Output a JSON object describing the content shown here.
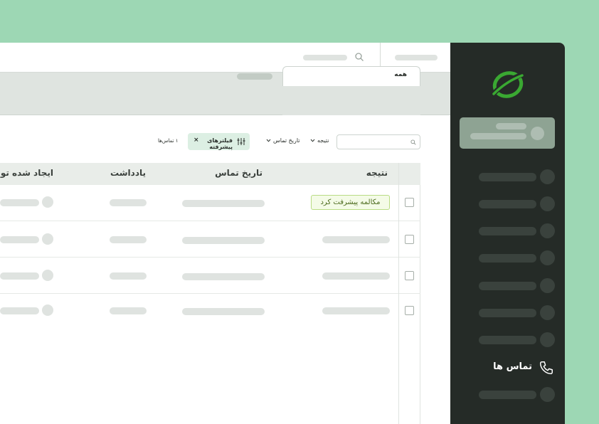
{
  "sidebar": {
    "contacts_label": "تماس ها"
  },
  "tabs": {
    "active_label": "همه"
  },
  "filters": {
    "result_label": "نتیجه",
    "contact_date_label": "تاریخ تماس",
    "advanced_label": "فیلترهای پیشرفته",
    "clear_symbol": "×",
    "count_label": "۱ تماس‌ها"
  },
  "table": {
    "headers": [
      "نتیجه",
      "تاریخ تماس",
      "یادداشت",
      "ایجاد شده توسط"
    ],
    "rows": [
      {
        "result": "مکالمه پیشرفت کرد"
      }
    ]
  },
  "colors": {
    "background": "#9dd7b4",
    "sidebar": "#252b27",
    "accent": "#3aa832",
    "badge_border": "#b9dc84"
  },
  "icons": [
    "logo-icon",
    "search-icon",
    "phone-icon",
    "sliders-icon",
    "chevron-down-icon",
    "close-icon"
  ]
}
